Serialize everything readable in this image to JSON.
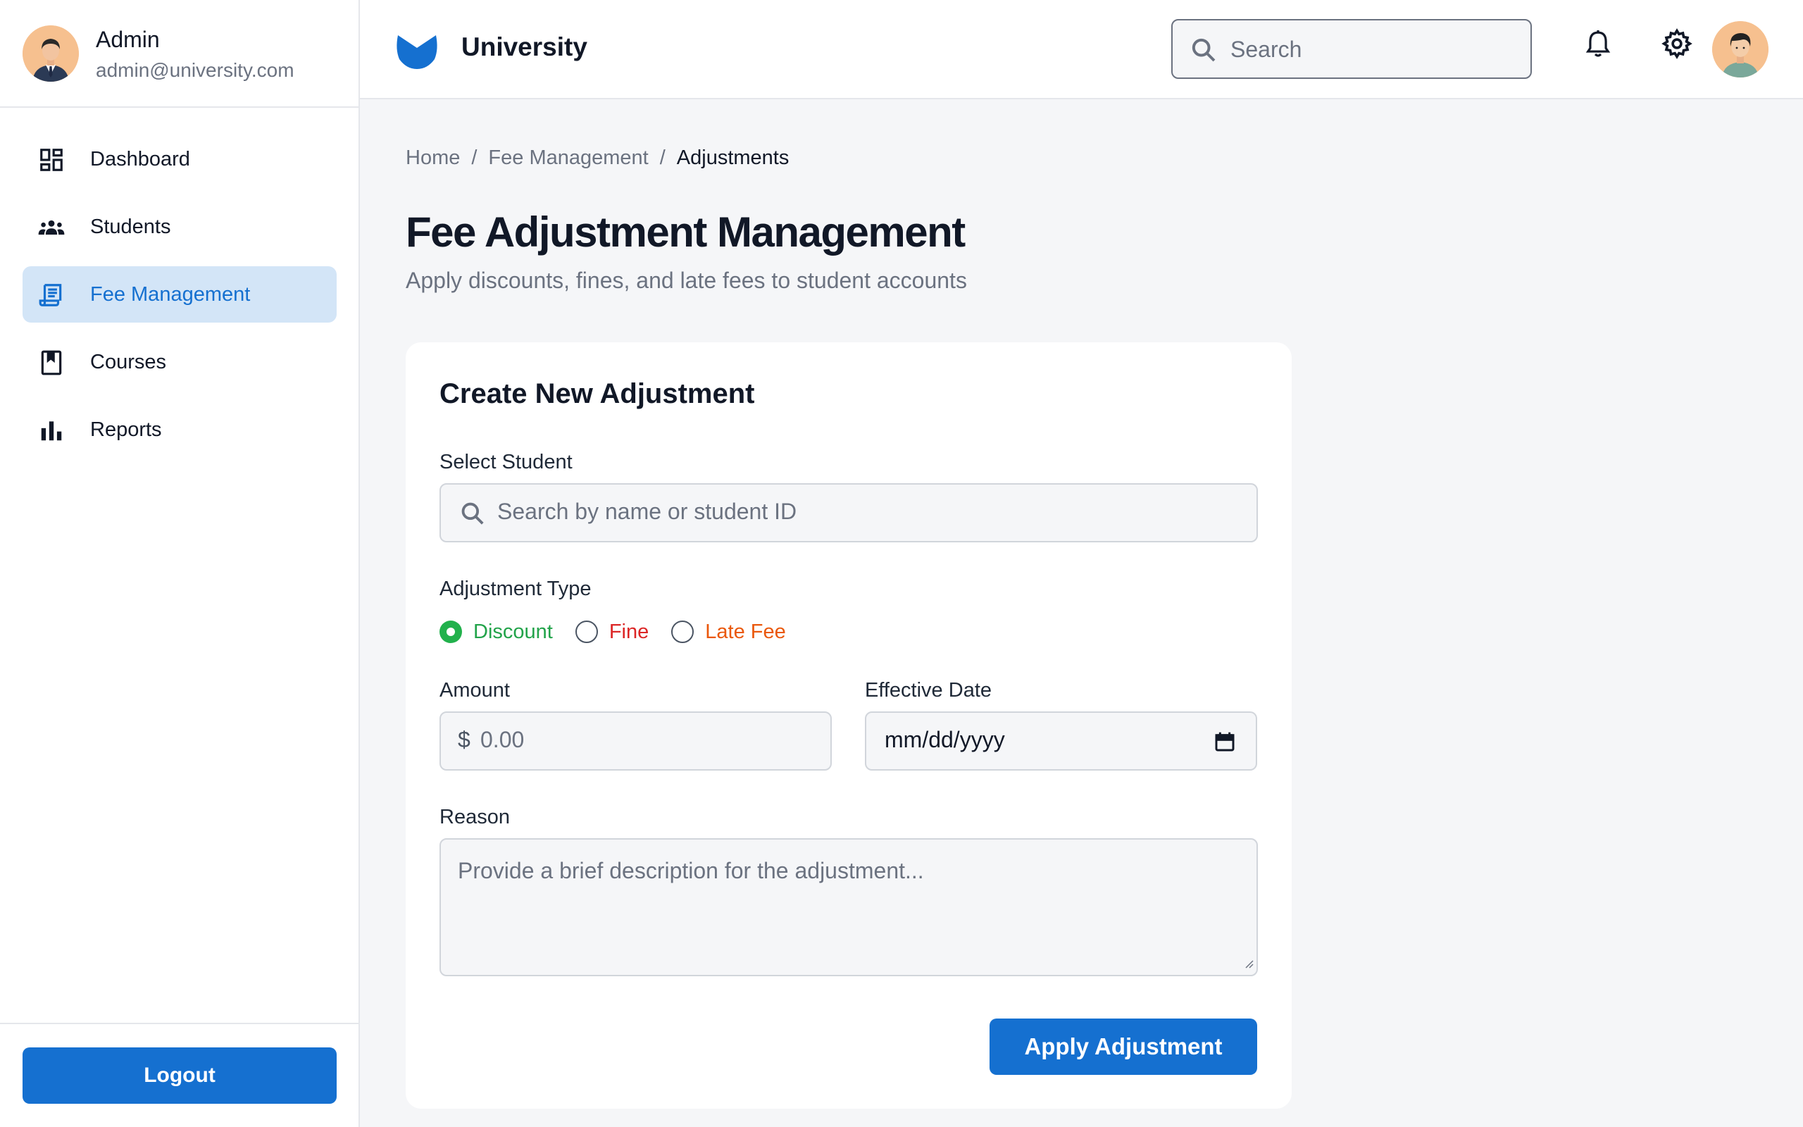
{
  "sidebar": {
    "user": {
      "name": "Admin",
      "email": "admin@university.com"
    },
    "items": [
      {
        "label": "Dashboard",
        "icon": "dashboard-icon"
      },
      {
        "label": "Students",
        "icon": "people-icon"
      },
      {
        "label": "Fee Management",
        "icon": "receipt-icon",
        "active": true
      },
      {
        "label": "Courses",
        "icon": "book-icon"
      },
      {
        "label": "Reports",
        "icon": "bar-chart-icon"
      }
    ],
    "logout_label": "Logout"
  },
  "header": {
    "brand": "University",
    "search_placeholder": "Search",
    "icons": [
      "bell-icon",
      "gear-icon"
    ]
  },
  "breadcrumb": {
    "items": [
      "Home",
      "Fee Management",
      "Adjustments"
    ],
    "separator": "/"
  },
  "page": {
    "title": "Fee Adjustment Management",
    "subtitle": "Apply discounts, fines, and late fees to student accounts"
  },
  "form": {
    "title": "Create New Adjustment",
    "student": {
      "label": "Select Student",
      "placeholder": "Search by name or student ID"
    },
    "adjustment_type": {
      "label": "Adjustment Type",
      "options": [
        {
          "label": "Discount",
          "color": "#22a34a",
          "checked": true
        },
        {
          "label": "Fine",
          "color": "#dc2626",
          "checked": false
        },
        {
          "label": "Late Fee",
          "color": "#ea580c",
          "checked": false
        }
      ]
    },
    "amount": {
      "label": "Amount",
      "prefix": "$",
      "placeholder": "0.00"
    },
    "effective_date": {
      "label": "Effective Date",
      "placeholder": "mm/dd/yyyy"
    },
    "reason": {
      "label": "Reason",
      "placeholder": "Provide a brief description for the adjustment..."
    },
    "submit_label": "Apply Adjustment"
  },
  "colors": {
    "primary": "#1570d0",
    "active_nav_bg": "#d3e5f7",
    "page_bg": "#f5f6f8"
  }
}
